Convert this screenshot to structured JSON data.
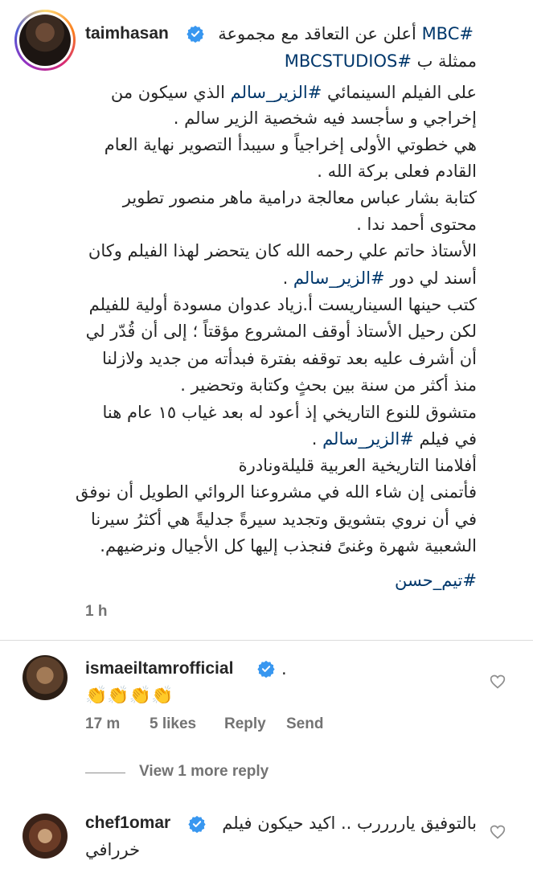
{
  "post": {
    "username": "taimhasan",
    "caption_lines": [
      {
        "text": "#MBC أعلن عن التعاقد مع مجموعة",
        "tag": true
      },
      {
        "text": "ممثلة ب #MBCSTUDIOS",
        "tag": true
      },
      {
        "text": "على الفيلم السينمائي #الزير_سالم الذي سيكون من",
        "tag": true
      },
      {
        "text": "إخراجي و سأجسد فيه شخصية الزير سالم .",
        "tag": false
      },
      {
        "text": "هي خطوتي الأولى إخراجياً و سيبدأ التصوير نهاية العام",
        "tag": false
      },
      {
        "text": "القادم فعلى بركة الله .",
        "tag": false
      },
      {
        "text": "كتابة بشار عباس معالجة درامية ماهر منصور تطوير",
        "tag": false
      },
      {
        "text": "محتوى أحمد ندا .",
        "tag": false
      },
      {
        "text": "الأستاذ حاتم علي رحمه الله كان يتحضر لهذا الفيلم وكان",
        "tag": false
      },
      {
        "text": "أسند لي دور #الزير_سالم .",
        "tag": true
      },
      {
        "text": "كتب حينها السيناريست أ.زياد عدوان مسودة أولية للفيلم",
        "tag": false
      },
      {
        "text": "لكن رحيل الأستاذ أوقف المشروع مؤقتاً ؛ إلى أن قُدّر لي",
        "tag": false
      },
      {
        "text": "أن أشرف عليه بعد توقفه بفترة فبدأته من جديد ولازلنا",
        "tag": false
      },
      {
        "text": "منذ أكثر من سنة بين بحثٍ وكتابة وتحضير .",
        "tag": false
      },
      {
        "text": "متشوق للنوع التاريخي إذ أعود له بعد غياب ١٥ عام هنا",
        "tag": false
      },
      {
        "text": "في فيلم #الزير_سالم .",
        "tag": true
      },
      {
        "text": "أفلامنا التاريخية العربية قليلةونادرة",
        "tag": false
      },
      {
        "text": "فأتمنى إن شاء الله في مشروعنا الروائي الطويل أن نوفق",
        "tag": false
      },
      {
        "text": "في أن نروي بتشويق وتجديد سيرةً جدليةً هي أكثرُ سيرنا",
        "tag": false
      },
      {
        "text": "الشعبية شهرة وغنىً فنجذب إليها كل الأجيال ونرضيهم.",
        "tag": false
      },
      {
        "text": "#تيم_حسن",
        "tag": true
      }
    ],
    "time": "1 h"
  },
  "comments": [
    {
      "username": "ismaeiltamrofficial",
      "suffix": ".",
      "text": "👏👏👏👏",
      "time": "17 m",
      "likes": "5 likes",
      "reply": "Reply",
      "send": "Send",
      "view_replies": "View 1 more reply"
    },
    {
      "username": "chef1omar",
      "text_line1": "بالتوفيق ياررررب .. اكيد حيكون فيلم",
      "text_line2": "خررافي"
    }
  ],
  "colors": {
    "link": "#00376b",
    "meta": "#737373",
    "verified": "#3897f0"
  }
}
